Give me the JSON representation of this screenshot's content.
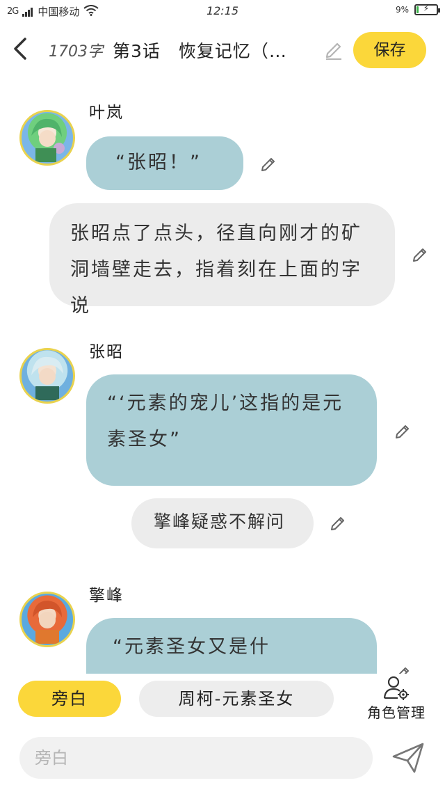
{
  "status_bar": {
    "signal": "2G",
    "carrier": "中国移动",
    "time": "12:15",
    "battery_text": "9%",
    "battery_level": 0.09,
    "wifi_icon": "wifi-icon"
  },
  "header": {
    "word_count": "1703字",
    "chapter_title": "第3话　恢复记忆（…",
    "save_label": "保存"
  },
  "messages": [
    {
      "speaker": "叶岚",
      "text": "“张昭！”"
    },
    {
      "text": "张昭点了点头，径直向刚才的矿洞墙壁走去，指着刻在上面的字说"
    },
    {
      "speaker": "张昭",
      "text": "“‘元素的宠儿’这指的是元素圣女”"
    },
    {
      "text": "擎峰疑惑不解问"
    },
    {
      "speaker": "擎峰",
      "text": "“元素圣女又是什"
    }
  ],
  "roles": {
    "aside_label": "旁白",
    "character_label": "周柯-元素圣女",
    "manage_label": "角色管理"
  },
  "input": {
    "placeholder": "旁白"
  },
  "colors": {
    "accent_yellow": "#fbd73a",
    "dialog_bubble": "#abcfd6",
    "narration_bubble": "#ececec"
  }
}
